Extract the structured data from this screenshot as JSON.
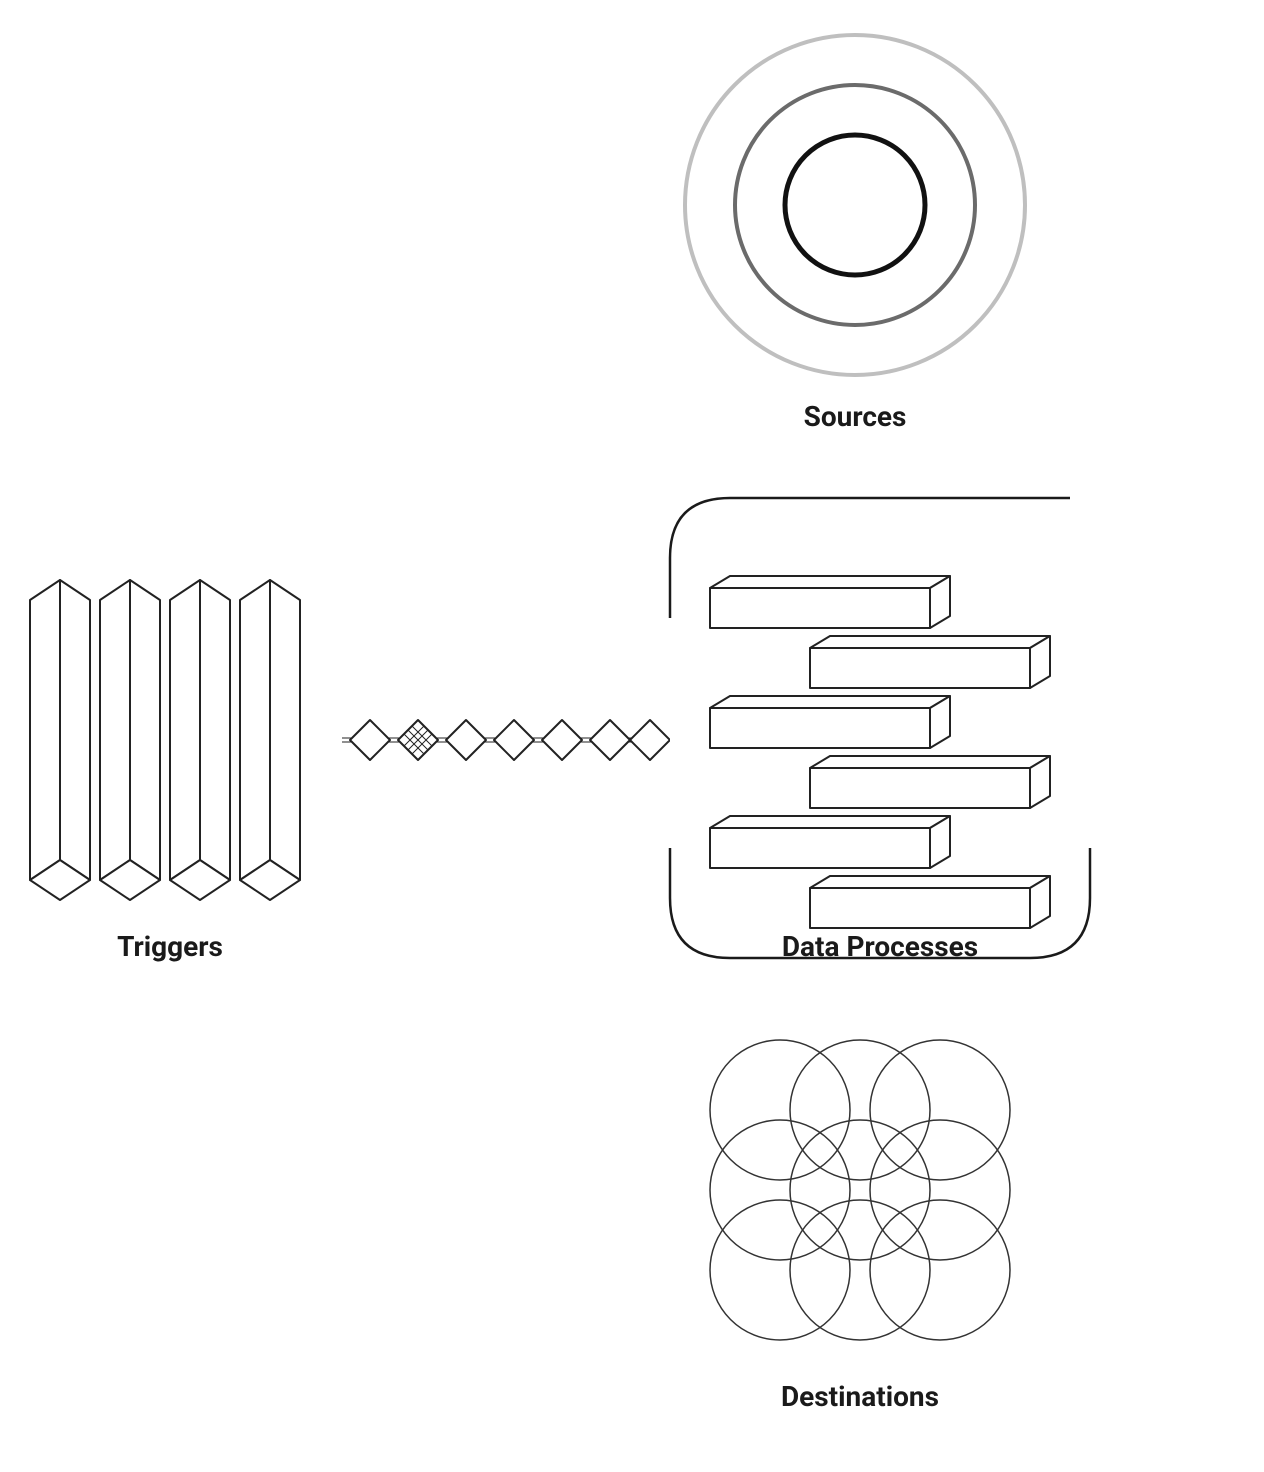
{
  "diagram": {
    "nodes": {
      "triggers": {
        "label": "Triggers"
      },
      "sources": {
        "label": "Sources"
      },
      "dataProcesses": {
        "label": "Data Processes"
      },
      "destinations": {
        "label": "Destinations"
      }
    },
    "flow_description": "Triggers feed a chain of diamond steps that enters a looping Data Processes block. The loop draws from Sources (above) and writes to Destinations (below).",
    "icons": {
      "triggers": "vertical-slabs-icon",
      "sources": "concentric-circles-icon",
      "dataProcesses": "stacked-bars-icon",
      "destinations": "overlapping-circles-grid-icon",
      "chain": "diamond-chain-icon"
    }
  }
}
